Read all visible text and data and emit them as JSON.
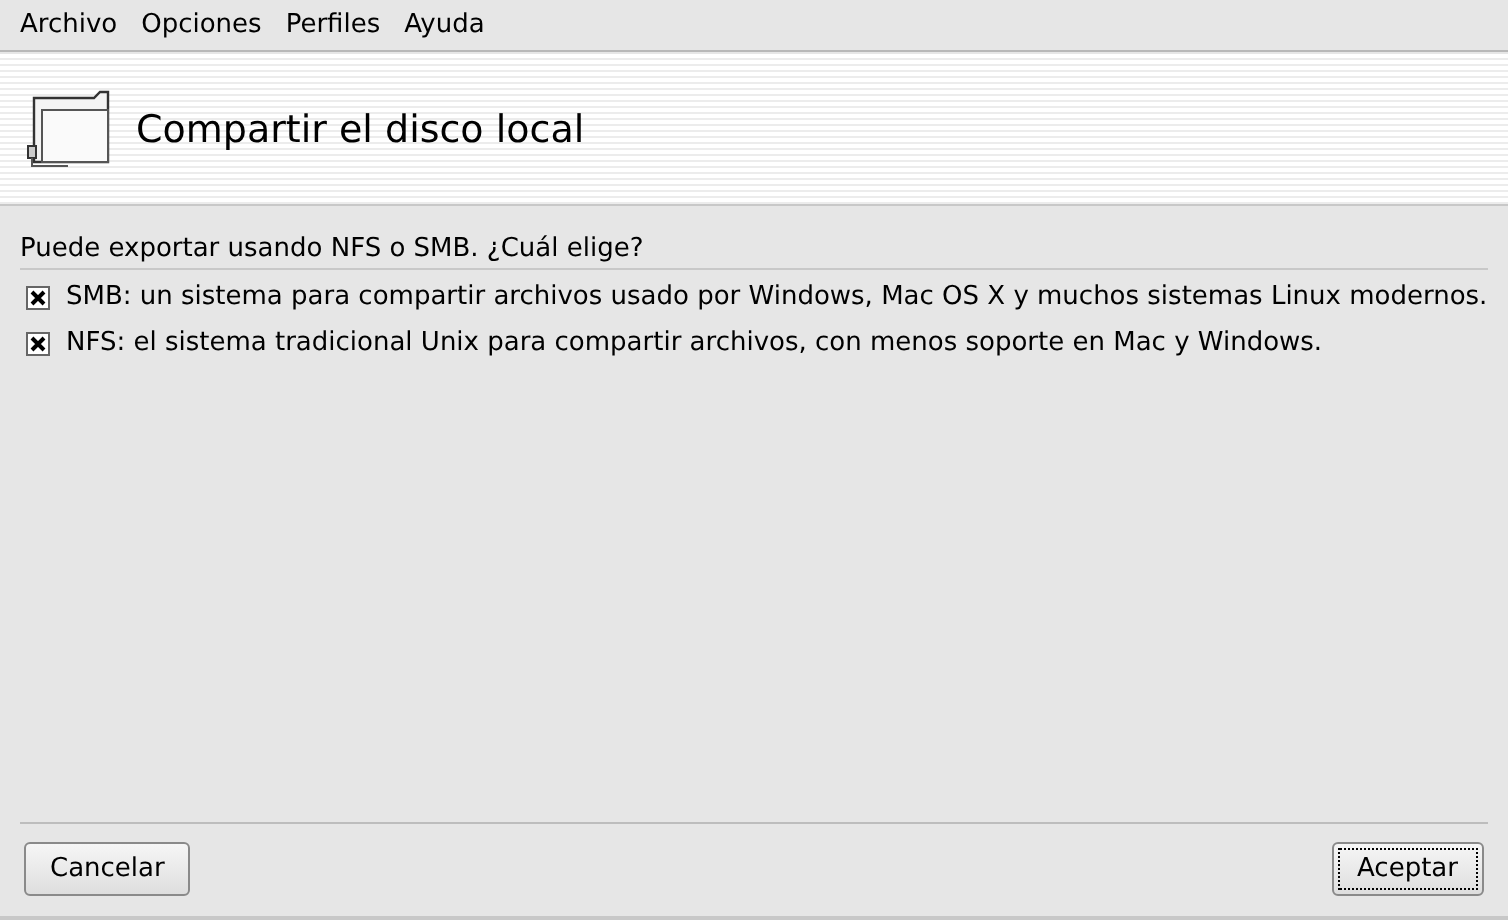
{
  "menu": [
    {
      "label": "Archivo"
    },
    {
      "label": "Opciones"
    },
    {
      "label": "Perfiles"
    },
    {
      "label": "Ayuda"
    }
  ],
  "header": {
    "title": "Compartir el disco local"
  },
  "question": "Puede exportar usando NFS o SMB. ¿Cuál elige?",
  "options": [
    {
      "label": "SMB: un sistema para compartir archivos usado por Windows, Mac OS X y muchos sistemas Linux modernos.",
      "checked": true
    },
    {
      "label": "NFS: el sistema tradicional Unix para compartir archivos, con menos soporte en Mac y Windows.",
      "checked": true
    }
  ],
  "buttons": [
    {
      "label": "Cancelar",
      "focused": false
    },
    {
      "label": "Aceptar",
      "focused": true
    }
  ]
}
